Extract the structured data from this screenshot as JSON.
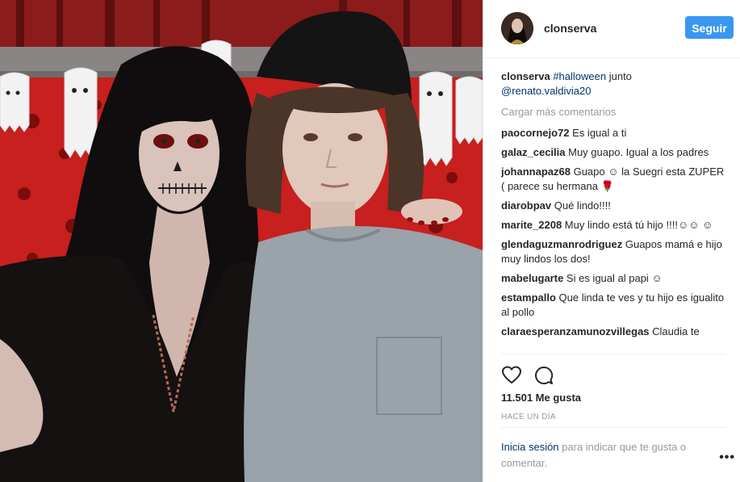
{
  "header": {
    "username": "clonserva",
    "follow_label": "Seguir"
  },
  "caption": {
    "username": "clonserva",
    "hashtag": "#halloween",
    "text": " junto",
    "mention": "@renato.valdivia20"
  },
  "load_more": "Cargar más comentarios",
  "comments": [
    {
      "user": "paocornejo72",
      "text": " Es igual a ti"
    },
    {
      "user": "galaz_cecilia",
      "text": " Muy guapo. Igual a los padres"
    },
    {
      "user": "johannapaz68",
      "text": " Guapo ☺ la Suegri esta ZUPER ( parece su hermana 🌹"
    },
    {
      "user": "diarobpav",
      "text": " Qué lindo!!!!"
    },
    {
      "user": "marite_2208",
      "text": " Muy lindo está tú hijo !!!!☺☺ ☺"
    },
    {
      "user": "glendaguzmanrodriguez",
      "text": " Guapos mamá e hijo muy lindos los dos!"
    },
    {
      "user": "mabelugarte",
      "text": " Si es igual al papi ☺"
    },
    {
      "user": "estampallo",
      "text": " Que linda te ves y tu hijo es igualito al pollo"
    },
    {
      "user": "claraesperanzamunozvillegas",
      "text": " Claudia te"
    }
  ],
  "likes": "11.501 Me gusta",
  "time": "HACE UN DÍA",
  "login": {
    "link": "Inicia sesión",
    "text": " para indicar que te gusta o comentar."
  },
  "icons": {
    "like": "heart-icon",
    "comment": "comment-icon",
    "more": "more-options-icon"
  },
  "colors": {
    "accent": "#3897f0",
    "link": "#003569",
    "muted": "#999999"
  }
}
